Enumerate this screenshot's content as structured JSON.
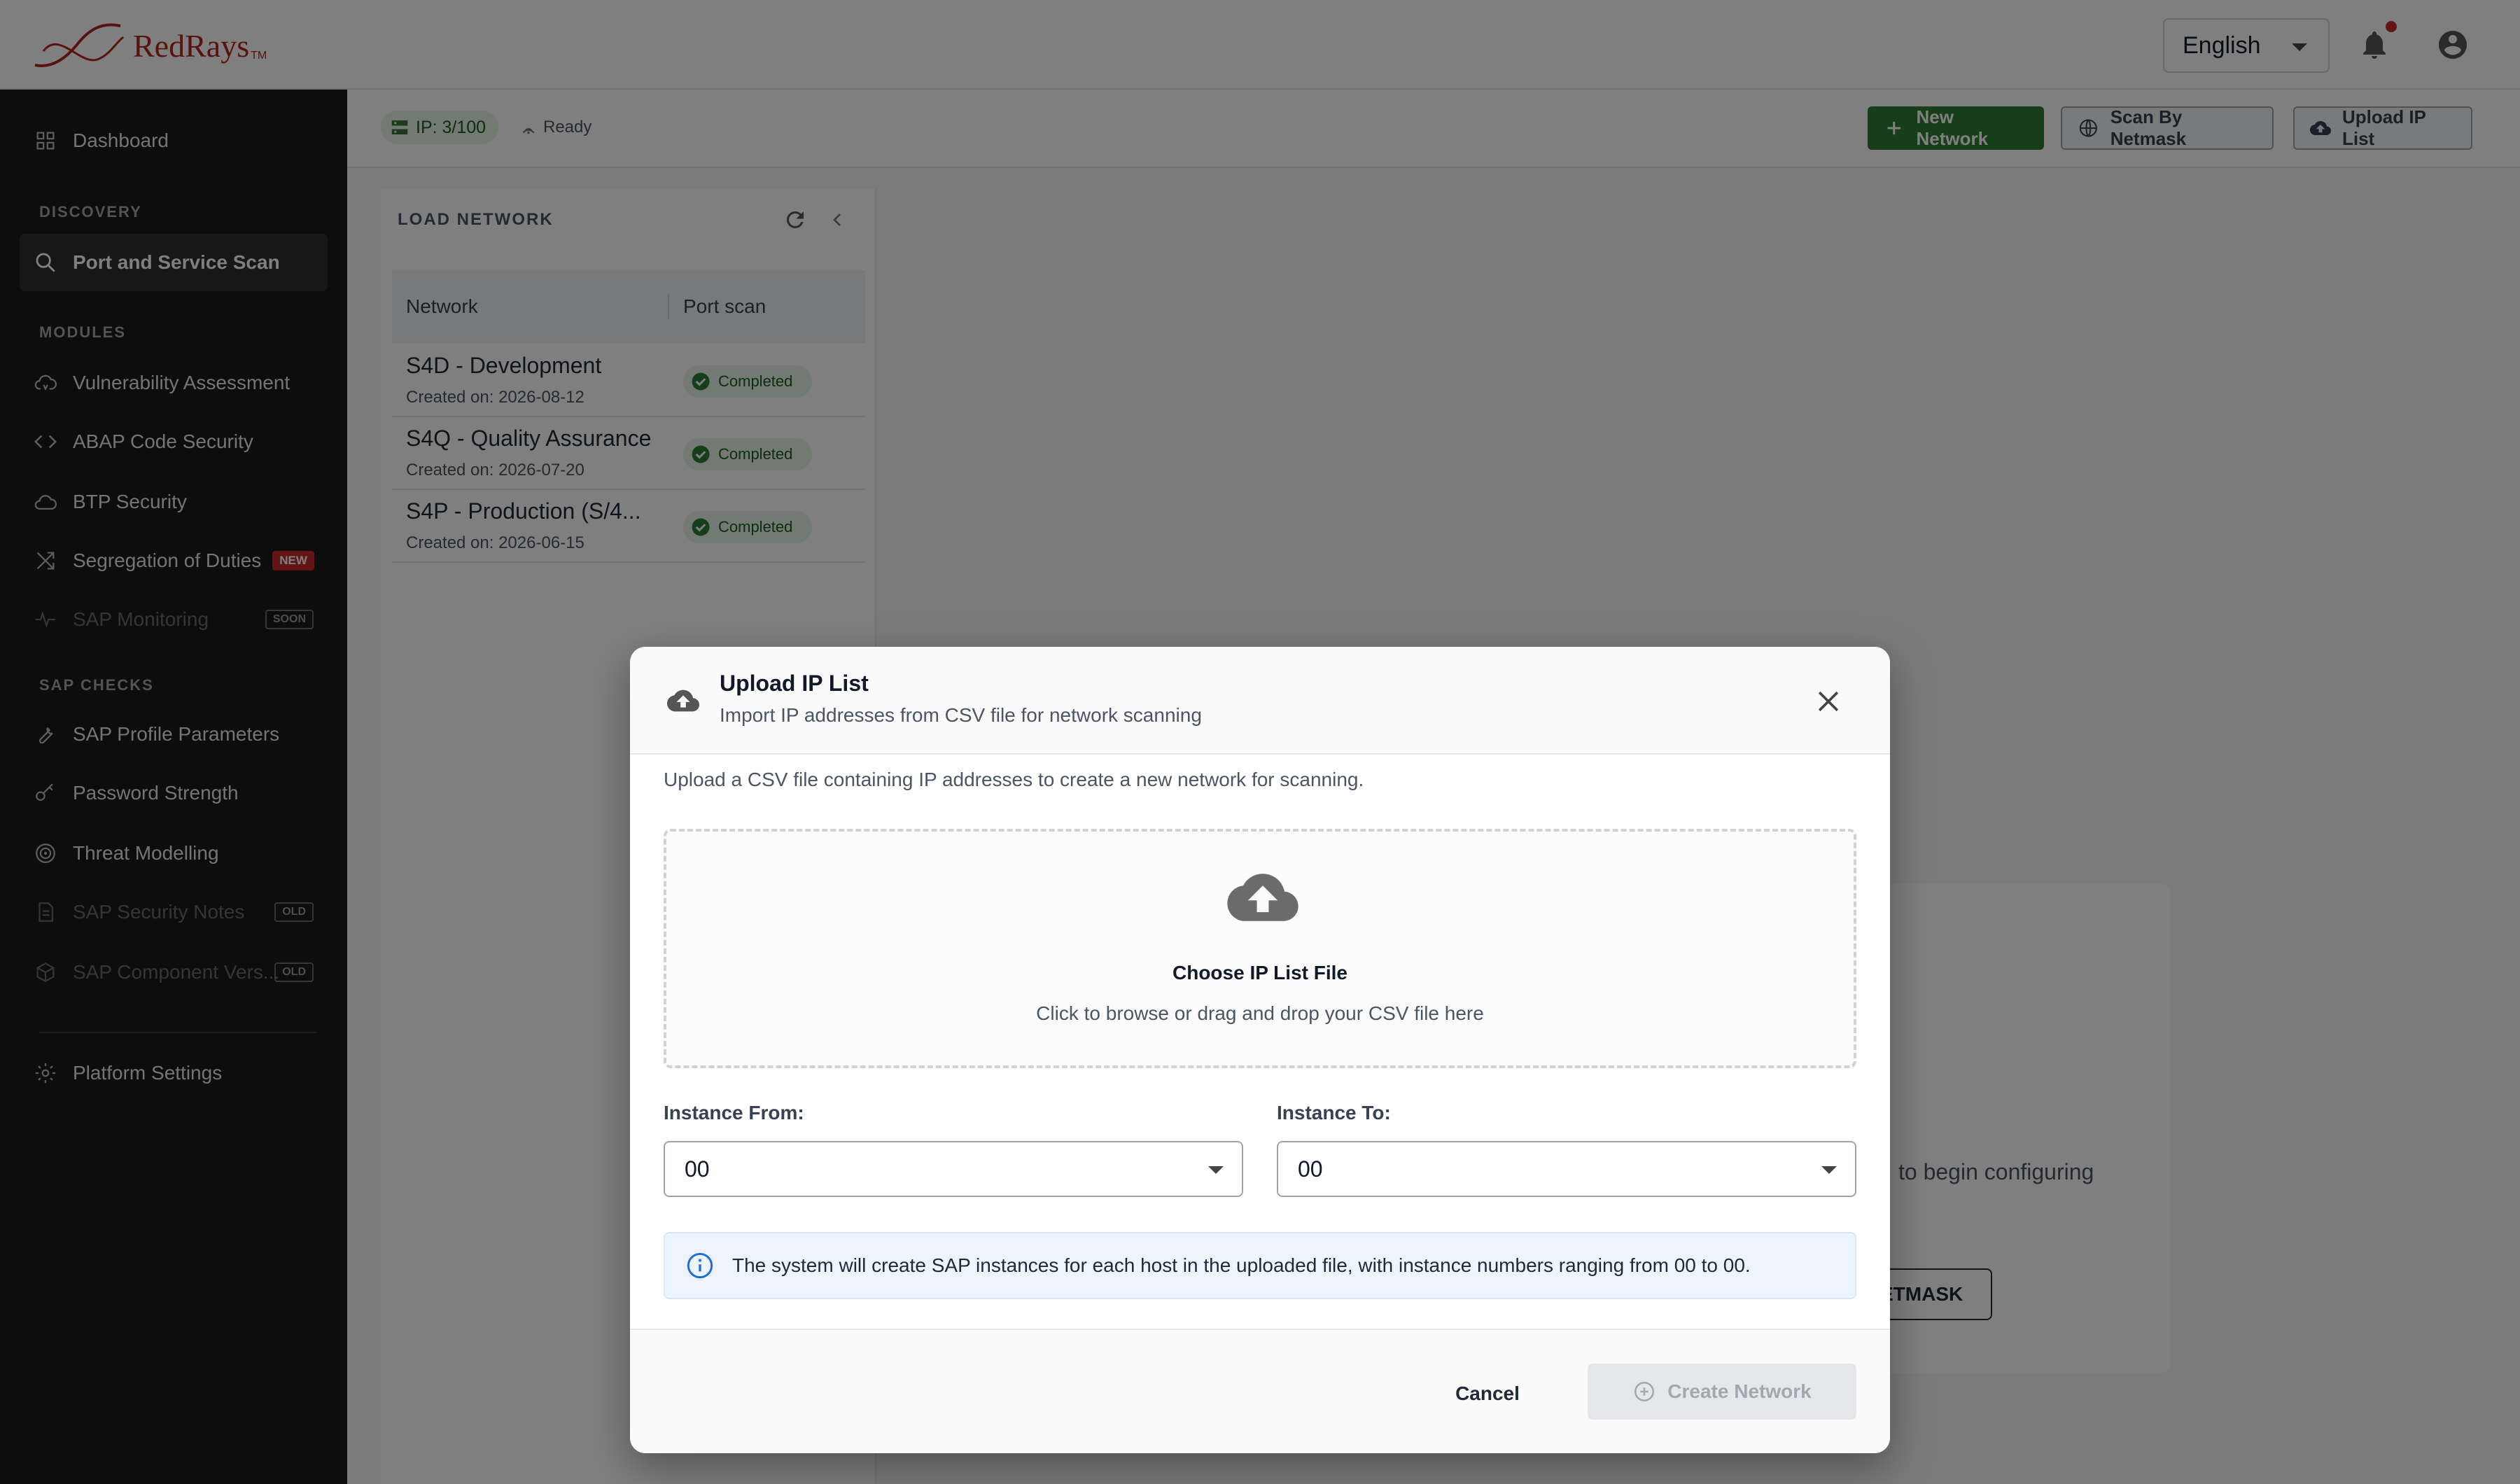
{
  "brand": {
    "name": "RedRays",
    "tm": "TM",
    "color": "#b3261e"
  },
  "header": {
    "language": "English",
    "icons": [
      "bell-icon",
      "account-circle-icon"
    ],
    "notification_dot_color": "#c62828"
  },
  "sidebar": {
    "dashboard": "Dashboard",
    "sections": {
      "discovery": "DISCOVERY",
      "modules": "MODULES",
      "sap_checks": "SAP CHECKS"
    },
    "items": {
      "port_scan": "Port and Service Scan",
      "vuln": "Vulnerability Assessment",
      "abap": "ABAP Code Security",
      "btp": "BTP Security",
      "sod": "Segregation of Duties",
      "sod_badge": "NEW",
      "monitoring": "SAP Monitoring",
      "monitoring_badge": "SOON",
      "profile": "SAP Profile Parameters",
      "password": "Password Strength",
      "threat": "Threat Modelling",
      "notes": "SAP Security Notes",
      "notes_badge": "OLD",
      "component": "SAP Component Vers...",
      "component_badge": "OLD",
      "settings": "Platform Settings"
    }
  },
  "subheader": {
    "ip_count": "IP: 3/100",
    "status": "Ready",
    "new_network": "New Network",
    "scan_by_netmask": "Scan By Netmask",
    "upload_ip_list": "Upload IP List",
    "accent": "#2e7d32"
  },
  "load_network": {
    "title": "LOAD NETWORK",
    "columns": {
      "network": "Network",
      "port_scan": "Port scan"
    },
    "rows": [
      {
        "name": "S4D - Development",
        "created": "Created on: 2026-08-12",
        "status": "Completed"
      },
      {
        "name": "S4Q - Quality Assurance",
        "created": "Created on: 2026-07-20",
        "status": "Completed"
      },
      {
        "name": "S4P - Production (S/4...",
        "created": "Created on: 2026-06-15",
        "status": "Completed"
      }
    ]
  },
  "background": {
    "hint_text": "to begin configuring",
    "button_text": "ETMASK"
  },
  "modal": {
    "title": "Upload IP List",
    "subtitle": "Import IP addresses from CSV file for network scanning",
    "description": "Upload a CSV file containing IP addresses to create a new network for scanning.",
    "dropzone_title": "Choose IP List File",
    "dropzone_subtitle": "Click to browse or drag and drop your CSV file here",
    "instance_from_label": "Instance From:",
    "instance_from_value": "00",
    "instance_to_label": "Instance To:",
    "instance_to_value": "00",
    "info": "The system will create SAP instances for each host in the uploaded file, with instance numbers ranging from 00 to 00.",
    "cancel": "Cancel",
    "create": "Create Network"
  }
}
